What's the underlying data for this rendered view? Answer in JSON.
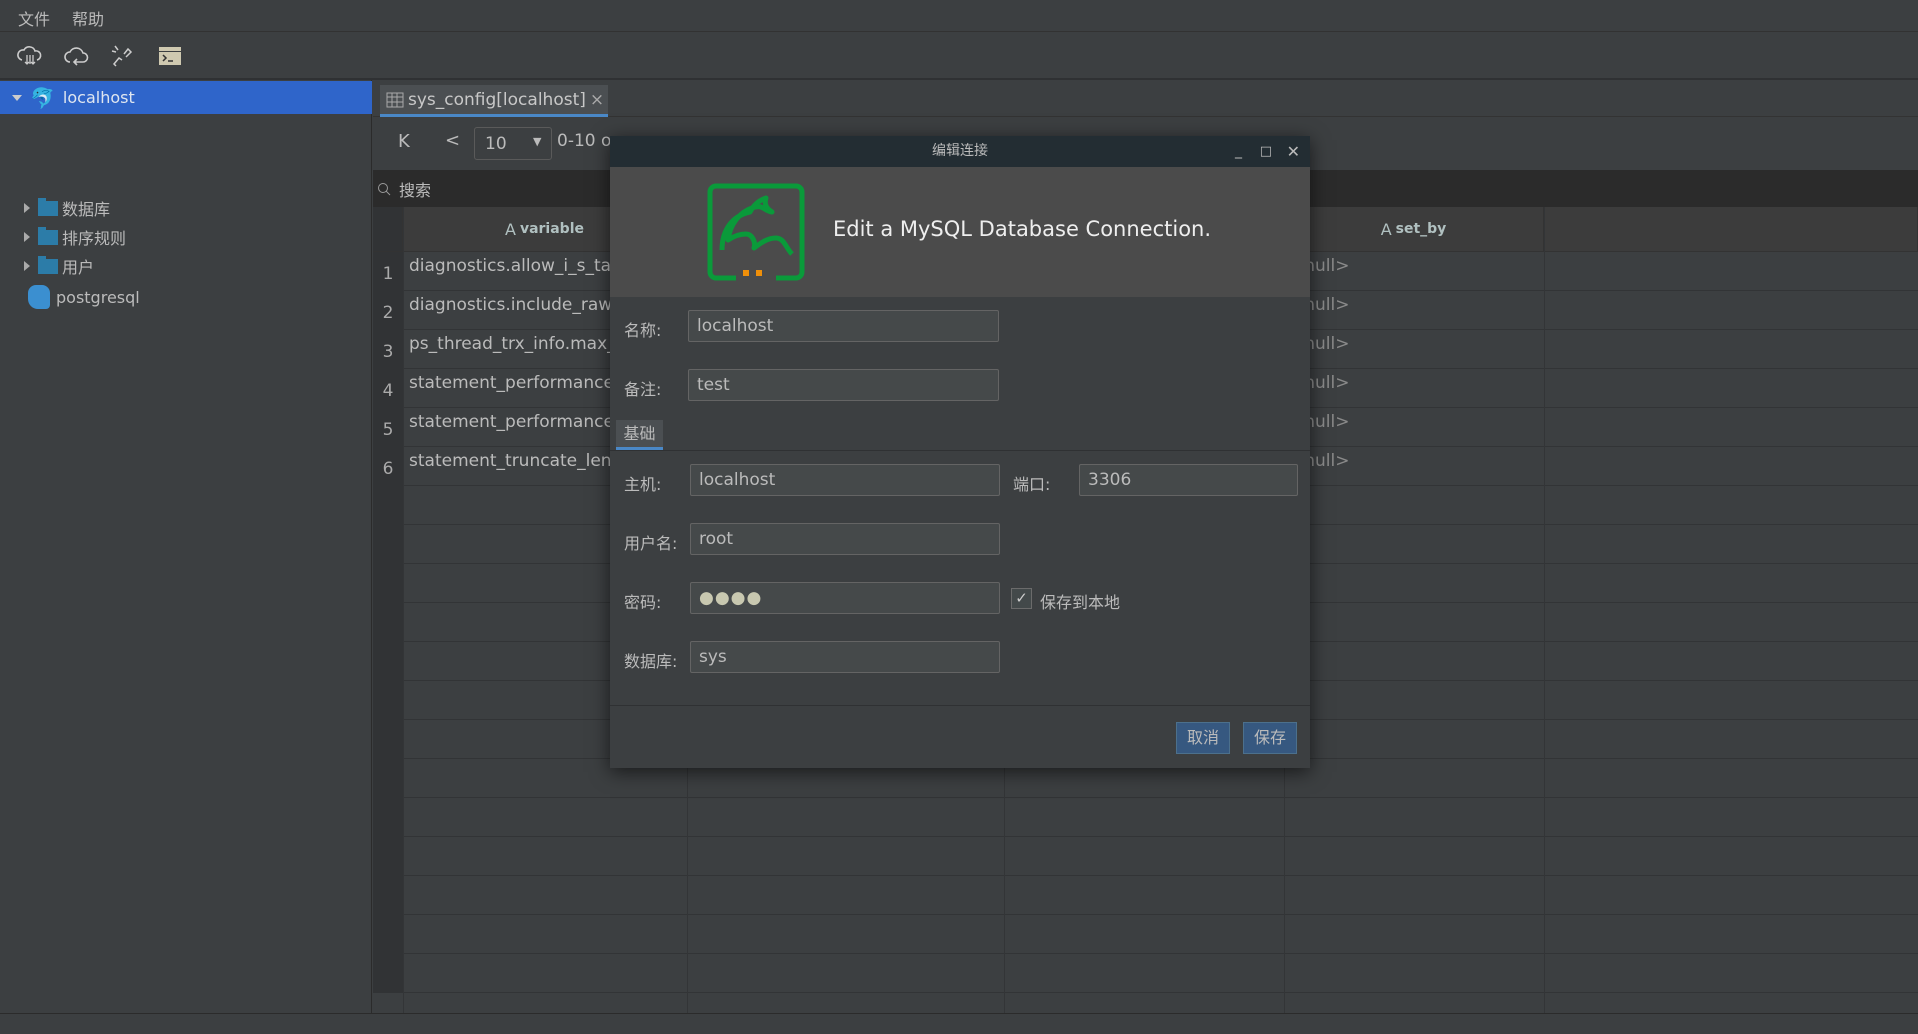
{
  "menu": [
    "文件",
    "帮助"
  ],
  "toolbar": [
    "cloud-download-icon",
    "cloud-refresh-icon",
    "disconnect-icon",
    "terminal-icon"
  ],
  "sidebar": {
    "items": [
      {
        "label": "localhost",
        "type": "mysql",
        "selected": true,
        "expanded": true
      },
      {
        "label": "数据库",
        "type": "folder"
      },
      {
        "label": "排序规则",
        "type": "folder"
      },
      {
        "label": "用户",
        "type": "folder"
      },
      {
        "label": "postgresql",
        "type": "postgresql"
      }
    ]
  },
  "tab": {
    "label": "sys_config[localhost]",
    "close": "×"
  },
  "pager": {
    "first": "K",
    "prev": "<",
    "page_size": "10",
    "range": "0-10 o"
  },
  "search": {
    "placeholder": "搜索"
  },
  "grid": {
    "columns": [
      "variable",
      "",
      "",
      "set_by"
    ],
    "rows": [
      {
        "n": "1",
        "variable": "diagnostics.allow_i_s_tables",
        "set_by": "<null>"
      },
      {
        "n": "2",
        "variable": "diagnostics.include_raw",
        "set_by": "<null>"
      },
      {
        "n": "3",
        "variable": "ps_thread_trx_info.max_length",
        "set_by": "<null>"
      },
      {
        "n": "4",
        "variable": "statement_performance_analyzer.limit",
        "set_by": "<null>"
      },
      {
        "n": "5",
        "variable": "statement_performance_analyzer.view",
        "set_by": "<null>"
      },
      {
        "n": "6",
        "variable": "statement_truncate_len",
        "set_by": "<null>"
      }
    ]
  },
  "dialog": {
    "title": "编辑连接",
    "heading": "Edit a MySQL Database Connection.",
    "name_label": "名称:",
    "name": "localhost",
    "remark_label": "备注:",
    "remark": "test",
    "tab": "基础",
    "host_label": "主机:",
    "host": "localhost",
    "port_label": "端口:",
    "port": "3306",
    "user_label": "用户名:",
    "user": "root",
    "password_label": "密码:",
    "password": "●●●●",
    "save_local": "保存到本地",
    "save_local_checked": true,
    "db_label": "数据库:",
    "db": "sys",
    "cancel": "取消",
    "save": "保存"
  },
  "colors": {
    "accent": "#2f65ca",
    "logo": "#0a9a3a",
    "logo_dots": "#f0900a",
    "button": "#365880"
  }
}
